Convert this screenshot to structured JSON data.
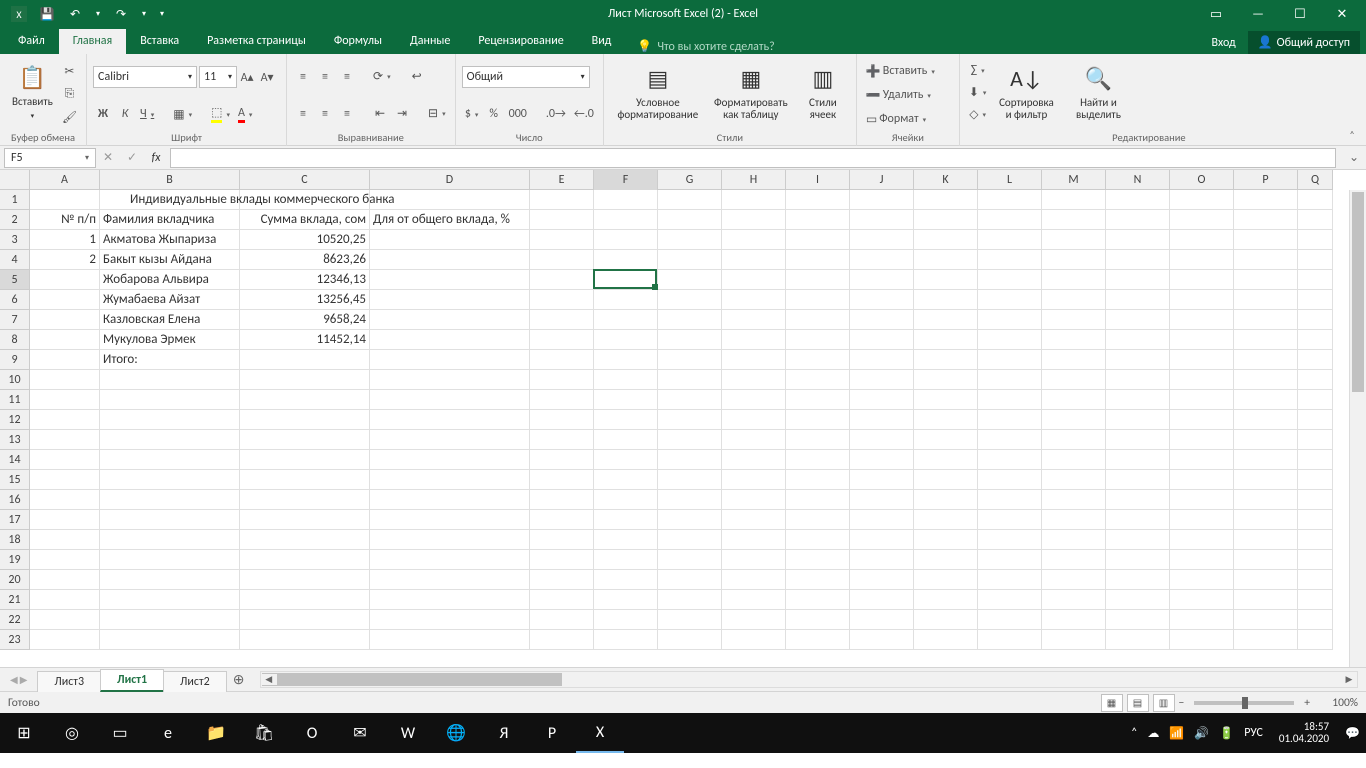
{
  "title": "Лист Microsoft Excel (2) - Excel",
  "qat": {
    "save": "💾",
    "undo": "↶",
    "redo": "↷"
  },
  "window": {
    "ribbonopts": "▭",
    "min": "—",
    "max": "☐",
    "close": "✕"
  },
  "tabs": {
    "file": "Файл",
    "home": "Главная",
    "insert": "Вставка",
    "layout": "Разметка страницы",
    "formulas": "Формулы",
    "data": "Данные",
    "review": "Рецензирование",
    "view": "Вид"
  },
  "tellme": "Что вы хотите сделать?",
  "login": "Вход",
  "share": "Общий доступ",
  "ribbon": {
    "clipboard": {
      "paste": "Вставить",
      "label": "Буфер обмена"
    },
    "font": {
      "name": "Calibri",
      "size": "11",
      "label": "Шрифт",
      "bold": "Ж",
      "italic": "К",
      "underline": "Ч"
    },
    "align": {
      "label": "Выравнивание"
    },
    "number": {
      "format": "Общий",
      "label": "Число"
    },
    "styles": {
      "cond": "Условное форматирование",
      "table": "Форматировать как таблицу",
      "cell": "Стили ячеек",
      "label": "Стили"
    },
    "cells": {
      "insert": "Вставить",
      "delete": "Удалить",
      "format": "Формат",
      "label": "Ячейки"
    },
    "editing": {
      "sort": "Сортировка и фильтр",
      "find": "Найти и выделить",
      "label": "Редактирование"
    }
  },
  "namebox": "F5",
  "columns": [
    {
      "l": "A",
      "w": 70
    },
    {
      "l": "B",
      "w": 140
    },
    {
      "l": "C",
      "w": 130
    },
    {
      "l": "D",
      "w": 160
    },
    {
      "l": "E",
      "w": 64
    },
    {
      "l": "F",
      "w": 64
    },
    {
      "l": "G",
      "w": 64
    },
    {
      "l": "H",
      "w": 64
    },
    {
      "l": "I",
      "w": 64
    },
    {
      "l": "J",
      "w": 64
    },
    {
      "l": "K",
      "w": 64
    },
    {
      "l": "L",
      "w": 64
    },
    {
      "l": "M",
      "w": 64
    },
    {
      "l": "N",
      "w": 64
    },
    {
      "l": "O",
      "w": 64
    },
    {
      "l": "P",
      "w": 64
    },
    {
      "l": "Q",
      "w": 35
    }
  ],
  "rowcount": 23,
  "selected_row": 5,
  "selected_col": "F",
  "data_rows": [
    {
      "r": 1,
      "B": "Индивидуальные вклады коммерческого банка",
      "Bspan": true
    },
    {
      "r": 2,
      "A": "№ п/п",
      "B": "Фамилия вкладчика",
      "C": "Сумма вклада, сом",
      "D": "Для от общего вклада, %"
    },
    {
      "r": 3,
      "A": "1",
      "B": "Акматова Жыпариза",
      "C": "10520,25"
    },
    {
      "r": 4,
      "A": "2",
      "B": "Бакыт кызы Айдана",
      "C": "8623,26"
    },
    {
      "r": 5,
      "B": "Жобарова Альвира",
      "C": "12346,13"
    },
    {
      "r": 6,
      "B": "Жумабаева Айзат",
      "C": "13256,45"
    },
    {
      "r": 7,
      "B": "Казловская Елена",
      "C": "9658,24"
    },
    {
      "r": 8,
      "B": "Мукулова Эрмек",
      "C": "11452,14"
    },
    {
      "r": 9,
      "B": "Итого:"
    }
  ],
  "sheets": [
    "Лист3",
    "Лист1",
    "Лист2"
  ],
  "active_sheet": 1,
  "status": "Готово",
  "zoom": "100%",
  "tray": {
    "lang": "РУС",
    "time": "18:57",
    "date": "01.04.2020"
  },
  "taskapps": [
    "⊞",
    "◎",
    "▭",
    "e",
    "📁",
    "🛍",
    "O",
    "✉",
    "W",
    "🌐",
    "Я",
    "P",
    "X"
  ]
}
